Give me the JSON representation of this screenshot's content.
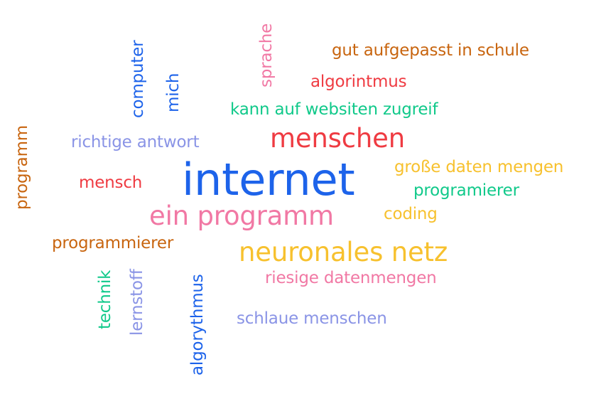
{
  "colors": {
    "orange": "#c8650f",
    "red": "#ef3b42",
    "pink": "#f178a4",
    "green": "#10c98a",
    "blue": "#1d63ea",
    "lavender": "#8a94e6",
    "yellow": "#f7c12e"
  },
  "words": [
    {
      "text": "gut aufgepasst in schule",
      "color": "orange",
      "weight": 2
    },
    {
      "text": "algorintmus",
      "color": "red",
      "weight": 2
    },
    {
      "text": "kann auf websiten zugreif",
      "color": "green",
      "weight": 2
    },
    {
      "text": "menschen",
      "color": "red",
      "weight": 4
    },
    {
      "text": "richtige antwort",
      "color": "lavender",
      "weight": 2
    },
    {
      "text": "mensch",
      "color": "red",
      "weight": 2
    },
    {
      "text": "internet",
      "color": "blue",
      "weight": 5
    },
    {
      "text": "große daten mengen",
      "color": "yellow",
      "weight": 2
    },
    {
      "text": "programierer",
      "color": "green",
      "weight": 2
    },
    {
      "text": "ein programm",
      "color": "pink",
      "weight": 4
    },
    {
      "text": "coding",
      "color": "yellow",
      "weight": 2
    },
    {
      "text": "programmierer",
      "color": "orange",
      "weight": 2
    },
    {
      "text": "neuronales netz",
      "color": "yellow",
      "weight": 4
    },
    {
      "text": "riesige datenmengen",
      "color": "pink",
      "weight": 2
    },
    {
      "text": "schlaue menschen",
      "color": "lavender",
      "weight": 2
    },
    {
      "text": "computer",
      "color": "blue",
      "weight": 2
    },
    {
      "text": "mich",
      "color": "blue",
      "weight": 2
    },
    {
      "text": "sprache",
      "color": "pink",
      "weight": 2
    },
    {
      "text": "programm",
      "color": "orange",
      "weight": 2
    },
    {
      "text": "technik",
      "color": "green",
      "weight": 2
    },
    {
      "text": "lernstoff",
      "color": "lavender",
      "weight": 2
    },
    {
      "text": "algorythmus",
      "color": "blue",
      "weight": 2
    }
  ]
}
